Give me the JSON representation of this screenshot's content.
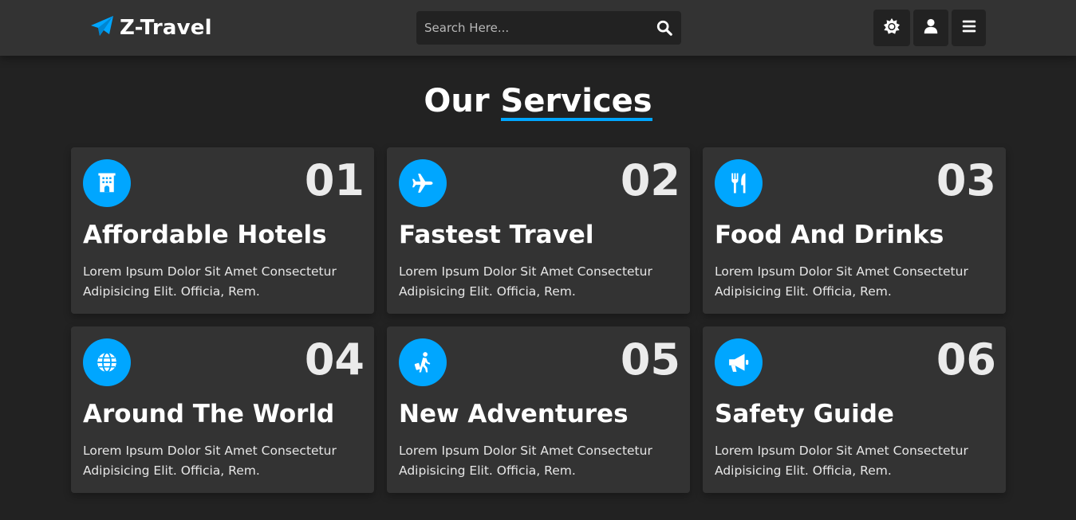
{
  "brand": {
    "name": "Z-Travel"
  },
  "search": {
    "placeholder": "Search Here..."
  },
  "header_buttons": [
    "theme-toggle",
    "user",
    "menu"
  ],
  "section": {
    "heading_plain": "Our",
    "heading_accent": "Services"
  },
  "colors": {
    "accent": "#00a6ff",
    "bg": "#222222",
    "card": "#333333"
  },
  "services": [
    {
      "number": "01",
      "icon": "hotel-icon",
      "title": "Affordable Hotels",
      "desc": "Lorem Ipsum Dolor Sit Amet Consectetur Adipisicing Elit. Officia, Rem."
    },
    {
      "number": "02",
      "icon": "plane-icon",
      "title": "Fastest Travel",
      "desc": "Lorem Ipsum Dolor Sit Amet Consectetur Adipisicing Elit. Officia, Rem."
    },
    {
      "number": "03",
      "icon": "utensils-icon",
      "title": "Food And Drinks",
      "desc": "Lorem Ipsum Dolor Sit Amet Consectetur Adipisicing Elit. Officia, Rem."
    },
    {
      "number": "04",
      "icon": "globe-icon",
      "title": "Around The World",
      "desc": "Lorem Ipsum Dolor Sit Amet Consectetur Adipisicing Elit. Officia, Rem."
    },
    {
      "number": "05",
      "icon": "traveler-icon",
      "title": "New Adventures",
      "desc": "Lorem Ipsum Dolor Sit Amet Consectetur Adipisicing Elit. Officia, Rem."
    },
    {
      "number": "06",
      "icon": "bullhorn-icon",
      "title": "Safety Guide",
      "desc": "Lorem Ipsum Dolor Sit Amet Consectetur Adipisicing Elit. Officia, Rem."
    }
  ]
}
